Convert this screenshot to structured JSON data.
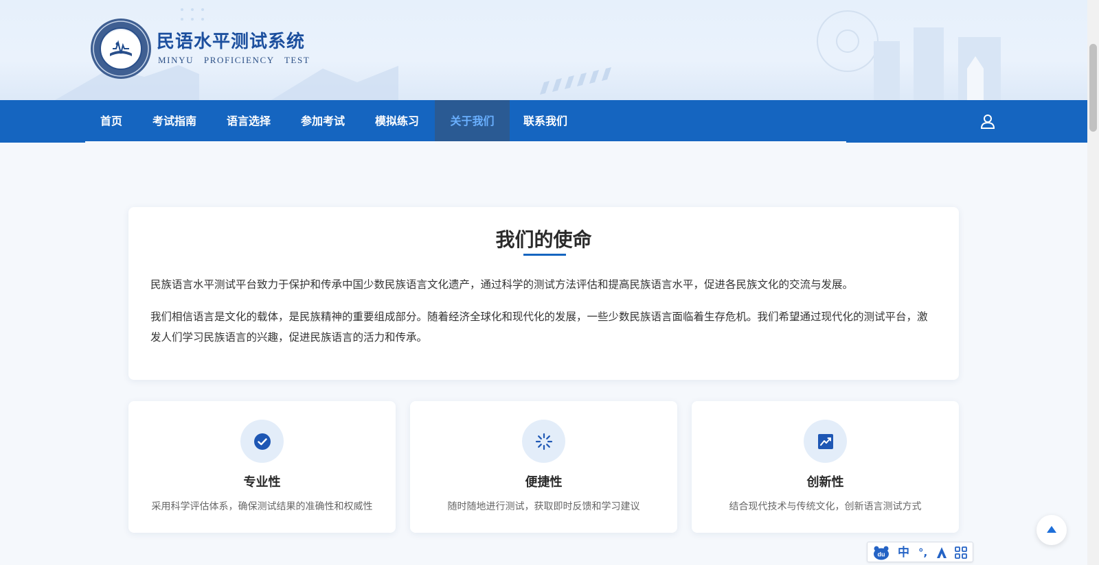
{
  "header": {
    "brand_cn": "民语水平测试系统",
    "brand_en": "MINYU PROFICIENCY TEST",
    "logo_icon": "seal-logo-icon"
  },
  "nav": {
    "items": [
      {
        "label": "首页",
        "active": false
      },
      {
        "label": "考试指南",
        "active": false
      },
      {
        "label": "语言选择",
        "active": false
      },
      {
        "label": "参加考试",
        "active": false
      },
      {
        "label": "模拟练习",
        "active": false
      },
      {
        "label": "关于我们",
        "active": true
      },
      {
        "label": "联系我们",
        "active": false
      }
    ],
    "user_icon": "user-icon"
  },
  "mission": {
    "title": "我们的使命",
    "paragraphs": [
      "民族语言水平测试平台致力于保护和传承中国少数民族语言文化遗产，通过科学的测试方法评估和提高民族语言水平，促进各民族文化的交流与发展。",
      "我们相信语言是文化的载体，是民族精神的重要组成部分。随着经济全球化和现代化的发展，一些少数民族语言面临着生存危机。我们希望通过现代化的测试平台，激发人们学习民族语言的兴趣，促进民族语言的活力和传承。"
    ]
  },
  "features": [
    {
      "icon": "check-circle-icon",
      "title": "专业性",
      "desc": "采用科学评估体系，确保测试结果的准确性和权威性"
    },
    {
      "icon": "spinner-icon",
      "title": "便捷性",
      "desc": "随时随地进行测试，获取即时反馈和学习建议"
    },
    {
      "icon": "chart-line-icon",
      "title": "创新性",
      "desc": "结合现代技术与传统文化，创新语言测试方式"
    }
  ],
  "ime": {
    "mode": "中",
    "punct": "°,"
  },
  "colors": {
    "nav_bg": "#1565c0",
    "nav_active_bg": "#2a5a93",
    "nav_active_text": "#6ab0ff",
    "accent": "#1565c0",
    "icon_bg": "#e3edf9"
  }
}
